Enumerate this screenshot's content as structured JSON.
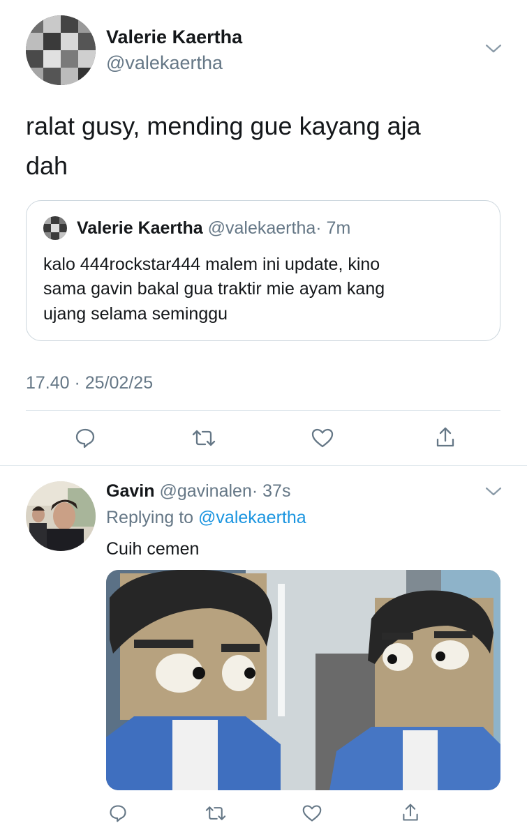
{
  "main_tweet": {
    "display_name": "Valerie Kaertha",
    "handle": "@valekaertha",
    "text_line1": "ralat gusy, mending gue kayang aja",
    "text_line2": "dah",
    "timestamp": "17.40 · 25/02/25",
    "quoted": {
      "display_name": "Valerie Kaertha",
      "handle": "@valekaertha",
      "time": "· 7m",
      "text_line1": "kalo 444rockstar444 malem ini update, kino",
      "text_line2": "sama gavin bakal gua traktir mie ayam kang",
      "text_line3": "ujang selama seminggu"
    }
  },
  "reply": {
    "display_name": "Gavin",
    "handle": "@gavinalen",
    "time": "· 37s",
    "replying_prefix": "Replying to",
    "replying_handle": "@valekaertha",
    "text": "Cuih cemen"
  },
  "icons": {
    "reply": "comment-icon",
    "retweet": "retweet-icon",
    "like": "heart-icon",
    "share": "share-icon",
    "menu": "chevron-down-icon"
  },
  "colors": {
    "link": "#1b95e0",
    "muted": "#657786",
    "text": "#14171a",
    "border": "#ccd6dd"
  }
}
